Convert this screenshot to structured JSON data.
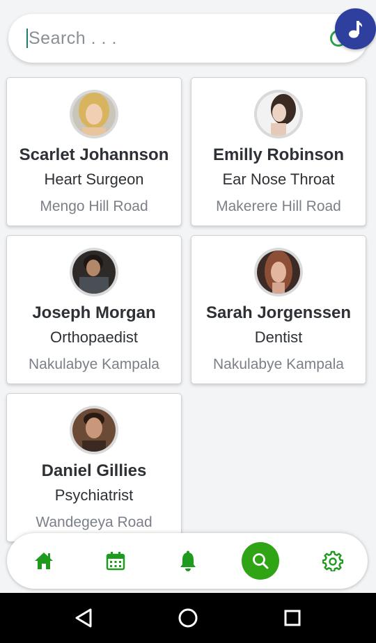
{
  "search": {
    "placeholder": "Search . . ."
  },
  "accent_color": "#2fa515",
  "fab_color": "#2e3f9e",
  "doctors": [
    {
      "name": "Scarlet Johannson",
      "specialty": "Heart Surgeon",
      "location": "Mengo Hill Road"
    },
    {
      "name": "Emilly Robinson",
      "specialty": "Ear Nose Throat",
      "location": "Makerere Hill Road"
    },
    {
      "name": "Joseph Morgan",
      "specialty": "Orthopaedist",
      "location": "Nakulabye Kampala"
    },
    {
      "name": "Sarah Jorgenssen",
      "specialty": "Dentist",
      "location": "Nakulabye Kampala"
    },
    {
      "name": "Daniel Gillies",
      "specialty": "Psychiatrist",
      "location": "Wandegeya Road"
    }
  ],
  "bottom_nav": {
    "items": [
      "home-icon",
      "calendar-icon",
      "bell-icon",
      "search-icon",
      "gear-icon"
    ],
    "active": "search-icon"
  },
  "system_nav": [
    "back-icon",
    "home-circle-icon",
    "recents-icon"
  ]
}
